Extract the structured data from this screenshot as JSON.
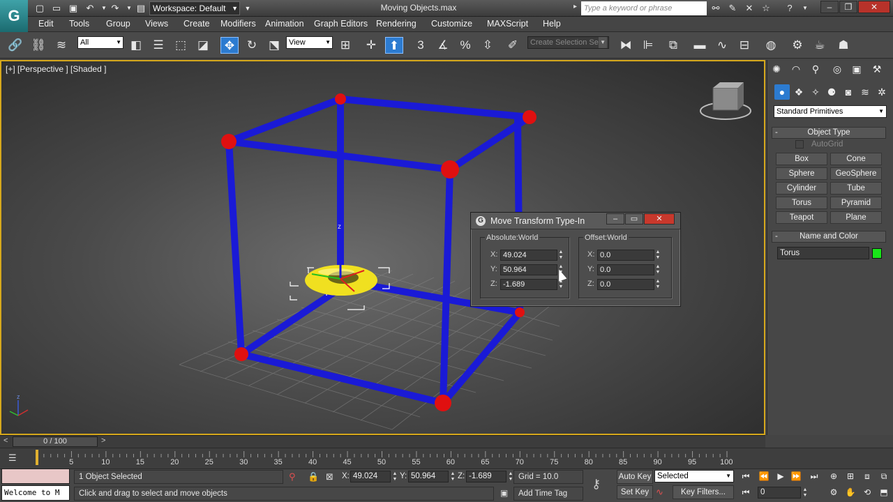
{
  "titlebar": {
    "app_logo": "G",
    "workspace": "Workspace: Default",
    "window_title": "Moving Objects.max",
    "search_placeholder": "Type a keyword or phrase"
  },
  "menu": [
    "Edit",
    "Tools",
    "Group",
    "Views",
    "Create",
    "Modifiers",
    "Animation",
    "Graph Editors",
    "Rendering",
    "Customize",
    "MAXScript",
    "Help"
  ],
  "toolbar": {
    "selection_filter": "All",
    "reference_coord": "View",
    "named_selection_placeholder": "Create Selection Se",
    "snap_label": "3",
    "percent_symbol": "%"
  },
  "viewport": {
    "label": "[+] [Perspective ] [Shaded ]",
    "gizmo_axis": "z",
    "corner_axis_label": "z"
  },
  "dialog": {
    "title": "Move Transform Type-In",
    "absolute": {
      "label": "Absolute:World",
      "x_label": "X:",
      "x": "49.024",
      "y_label": "Y:",
      "y": "50.964",
      "z_label": "Z:",
      "z": "-1.689"
    },
    "offset": {
      "label": "Offset:World",
      "x_label": "X:",
      "x": "0.0",
      "y_label": "Y:",
      "y": "0.0",
      "z_label": "Z:",
      "z": "0.0"
    }
  },
  "command_panel": {
    "category": "Standard Primitives",
    "object_type_title": "Object Type",
    "autogrid_label": "AutoGrid",
    "buttons": [
      "Box",
      "Cone",
      "Sphere",
      "GeoSphere",
      "Cylinder",
      "Tube",
      "Torus",
      "Pyramid",
      "Teapot",
      "Plane"
    ],
    "name_color_title": "Name and Color",
    "object_name": "Torus",
    "object_color": "#19e619",
    "collapse_symbol": "-"
  },
  "timeline": {
    "frame_display": "0 / 100",
    "prev": "<",
    "next": ">",
    "ticks": [
      "5",
      "10",
      "15",
      "20",
      "25",
      "30",
      "35",
      "40",
      "45",
      "50",
      "55",
      "60",
      "65",
      "70",
      "75",
      "80",
      "85",
      "90",
      "95",
      "100"
    ],
    "current_frame_value": 0,
    "frame_range_end": 100
  },
  "status": {
    "maxscript_text": "Welcome to M",
    "selection_count": "1 Object Selected",
    "prompt": "Click and drag to select and move objects",
    "x_label": "X:",
    "x": "49.024",
    "y_label": "Y:",
    "y": "50.964",
    "z_label": "Z:",
    "z": "-1.689",
    "grid": "Grid = 10.0",
    "add_time_tag": "Add Time Tag",
    "auto_key": "Auto Key",
    "set_key": "Set Key",
    "key_mode": "Selected",
    "key_filters": "Key Filters...",
    "current_frame": "0"
  },
  "colors": {
    "accent_blue": "#2c7bd0",
    "viewport_border": "#d6a81c",
    "frame_blue": "#1a1ad6",
    "sphere_red": "#e01010",
    "torus_yellow": "#f0e020"
  }
}
